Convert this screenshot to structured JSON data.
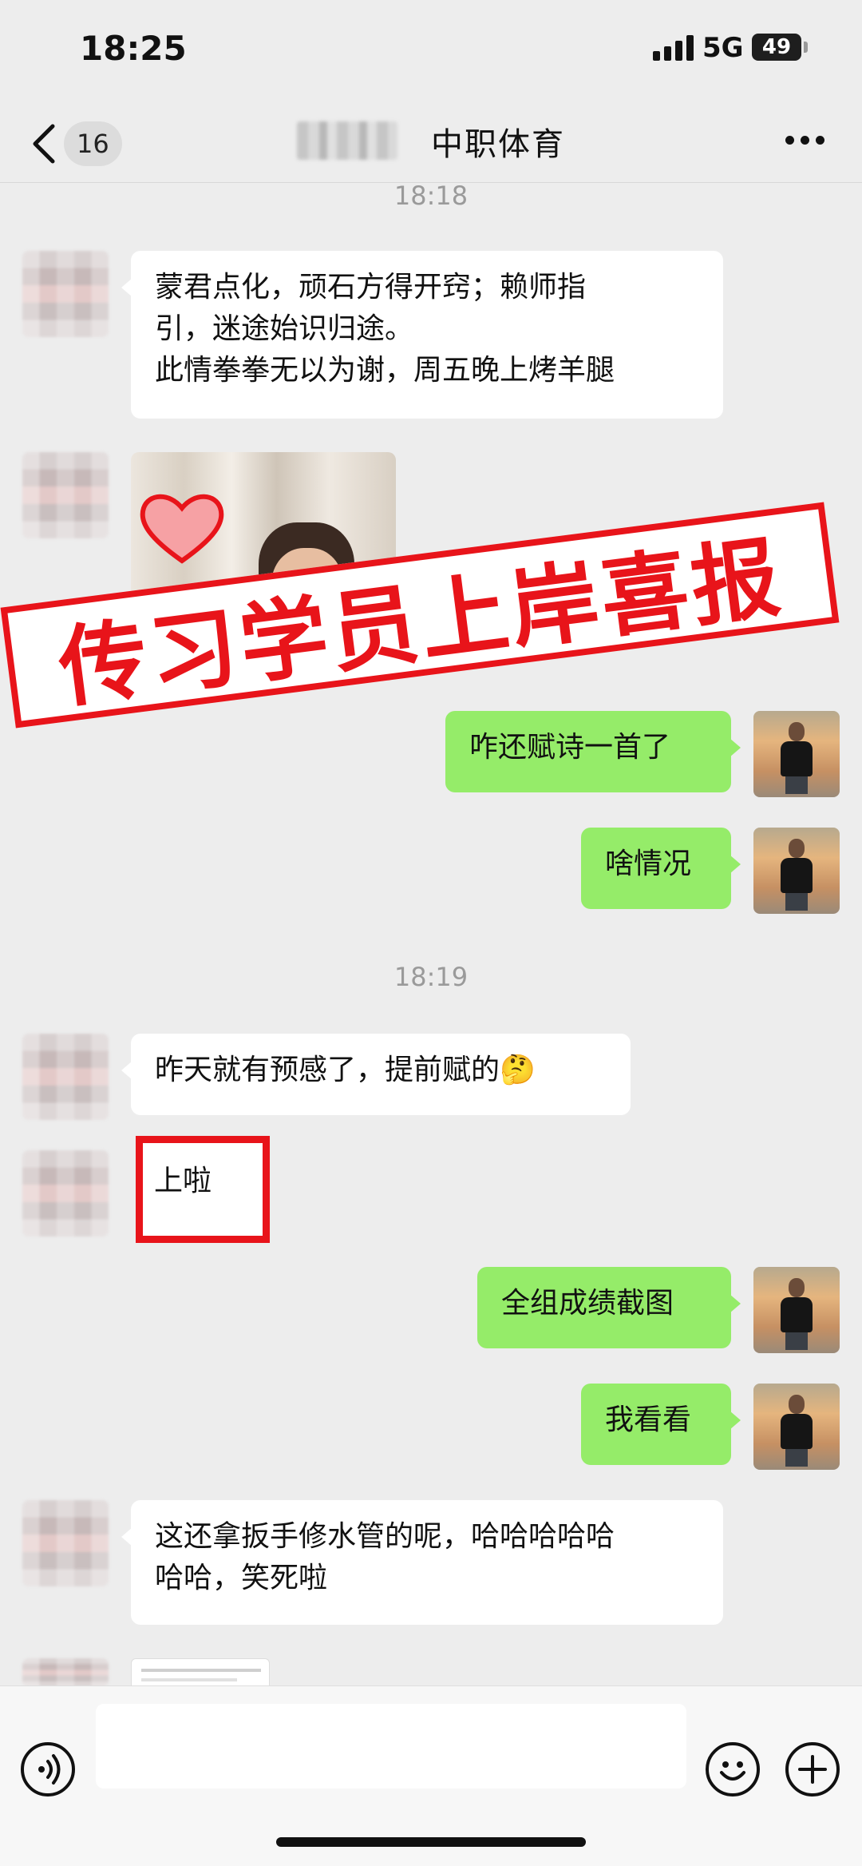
{
  "status_bar": {
    "time": "18:25",
    "network": "5G",
    "battery": "49"
  },
  "header": {
    "unread_count": "16",
    "title": "中职体育"
  },
  "timestamps": [
    "18:18",
    "18:19"
  ],
  "messages": [
    {
      "side": "left",
      "lines": [
        "蒙君点化，顽石方得开窍；赖师指",
        "引，迷途始识归途。",
        "此情拳拳无以为谢，周五晚上烤羊腿"
      ]
    },
    {
      "side": "left",
      "type": "image"
    },
    {
      "side": "right",
      "lines": [
        "咋还赋诗一首了"
      ]
    },
    {
      "side": "right",
      "lines": [
        "啥情况"
      ]
    },
    {
      "side": "left",
      "lines": [
        "昨天就有预感了，提前赋的🤔"
      ]
    },
    {
      "side": "left",
      "lines": [
        "上啦"
      ]
    },
    {
      "side": "right",
      "lines": [
        "全组成绩截图"
      ]
    },
    {
      "side": "right",
      "lines": [
        "我看看"
      ]
    },
    {
      "side": "left",
      "lines": [
        "这还拿扳手修水管的呢，哈哈哈哈哈",
        "哈哈，笑死啦"
      ]
    }
  ],
  "overlay": {
    "banner_text": "传习学员上岸喜报"
  },
  "icons": {
    "back": "chevron-left-icon",
    "more": "more-dots-icon",
    "voice": "voice-icon",
    "emoji": "emoji-icon",
    "plus": "plus-icon"
  },
  "colors": {
    "background": "#ededed",
    "right_bubble": "#95ec69",
    "left_bubble": "#ffffff",
    "highlight_red": "#e8141a"
  }
}
